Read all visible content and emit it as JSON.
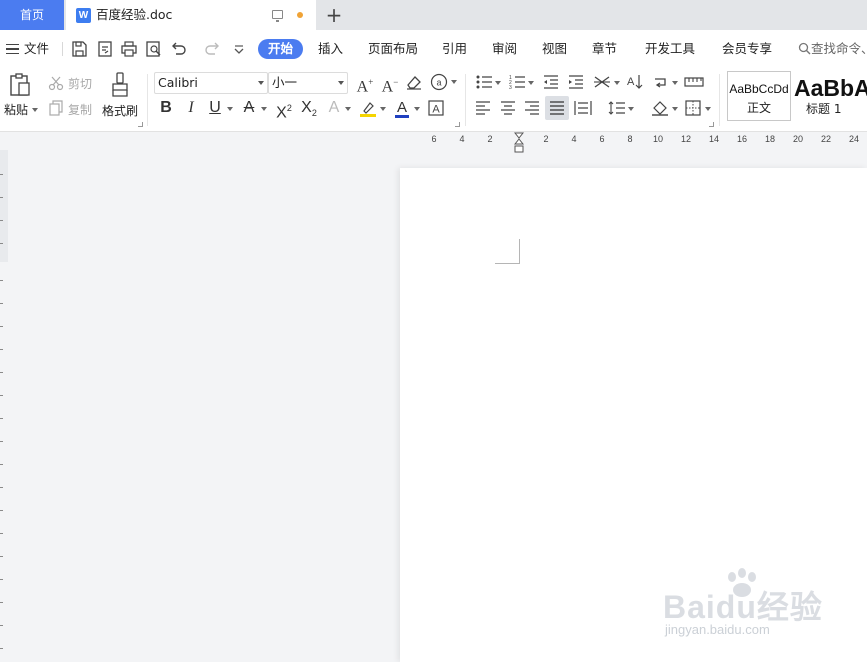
{
  "tabs": {
    "home": "首页",
    "document": "百度经验.doc",
    "doc_icon_letter": "W",
    "new_tab": "+"
  },
  "menu": {
    "file": "文件",
    "tabs": [
      "开始",
      "插入",
      "页面布局",
      "引用",
      "审阅",
      "视图",
      "章节",
      "开发工具",
      "会员专享"
    ],
    "active_tab": "开始",
    "search": "查找命令、"
  },
  "ribbon": {
    "paste": "粘贴",
    "cut": "剪切",
    "copy": "复制",
    "format_painter": "格式刷",
    "font_name": "Calibri",
    "font_size": "小一",
    "styles": [
      {
        "sample": "AaBbCcDd",
        "name": "正文"
      },
      {
        "sample": "AaBbA",
        "name": "标题 1"
      }
    ]
  },
  "ruler": {
    "labels": [
      "6",
      "4",
      "2",
      "",
      "2",
      "4",
      "6",
      "8",
      "10",
      "12",
      "14",
      "16",
      "18",
      "20",
      "22",
      "24"
    ]
  },
  "watermark": {
    "main": "Baidu经验",
    "sub": "jingyan.baidu.com"
  },
  "colors": {
    "accent": "#4b7cf0",
    "modified_dot": "#f0a336",
    "highlight_yellow": "#f5d400",
    "font_color_blue": "#2040c0"
  }
}
